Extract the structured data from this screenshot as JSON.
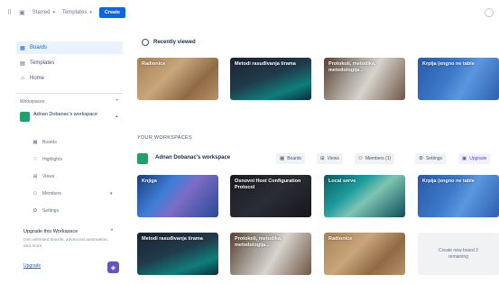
{
  "topbar": {
    "menu1": "Starred",
    "menu2": "Templates",
    "create": "Create"
  },
  "sidebar": {
    "nav": [
      {
        "label": "Boards",
        "icon": "board-icon"
      },
      {
        "label": "Templates",
        "icon": "template-icon"
      },
      {
        "label": "Home",
        "icon": "home-icon"
      }
    ],
    "workspaces_label": "Workspaces",
    "workspace_name": "Adnan Dobanac's workspace",
    "sub_items": [
      {
        "label": "Boards",
        "icon": "board-icon"
      },
      {
        "label": "Highlights",
        "icon": "heart-icon"
      },
      {
        "label": "Views",
        "icon": "grid-icon"
      },
      {
        "label": "Members",
        "icon": "members-icon"
      },
      {
        "label": "Settings",
        "icon": "gear-icon"
      }
    ],
    "upgrade_title": "Upgrade this Workspace",
    "upgrade_desc": "Get unlimited boards, advanced automation, and more",
    "upgrade_link": "Upgrade"
  },
  "main": {
    "recent_title": "Recently viewed",
    "recent_boards": [
      "Radionice",
      "Metodi rasuđivanja tirama",
      "Protokoli, metodika, metodologija...",
      "Krpija (engno ne table"
    ],
    "your_workspaces_title": "YOUR WORKSPACES",
    "workspace_name": "Adnan Dobanac's workspace",
    "workspace_buttons": [
      {
        "label": "Boards",
        "icon": "board-icon"
      },
      {
        "label": "Views",
        "icon": "grid-icon"
      },
      {
        "label": "Members (1)",
        "icon": "members-icon"
      },
      {
        "label": "Settings",
        "icon": "gear-icon"
      },
      {
        "label": "Upgrade",
        "icon": "upgrade-icon"
      }
    ],
    "workspace_boards": [
      "Knjiga",
      "Osnovni Host Configuration Protocol",
      "Local serve",
      "Krpija (engno ne table",
      "Metodi rasuđivanja tirama",
      "Protokoli, metodika, metodologija...",
      "Radionice"
    ],
    "create_new": "Create new board 2 remaining"
  },
  "colors": {
    "accent": "#0c66e4",
    "workspace_tile": "#22a06b",
    "help_button": "#6554c0"
  }
}
